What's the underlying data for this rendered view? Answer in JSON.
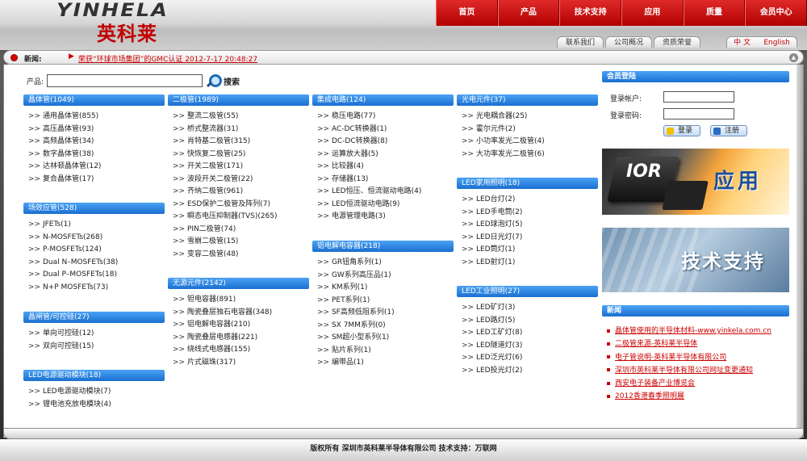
{
  "header": {
    "logo_en": "YINHELA",
    "logo_cn": "英科莱",
    "nav": [
      "首页",
      "产品",
      "技术支持",
      "应用",
      "质量",
      "会员中心"
    ],
    "subnav": [
      "联系我们",
      "公司概况",
      "资质荣誉"
    ],
    "lang": [
      "中 文",
      "English"
    ]
  },
  "news_ticker": {
    "label": "新闻:",
    "arrow": "▶",
    "text": "荣获“环球市场集团”的GMC认证   2012-7-17 20:48:27"
  },
  "search": {
    "label": "产品:",
    "value": "",
    "button": "搜索"
  },
  "categories": {
    "transistor": {
      "title": "晶体管(1049)",
      "items": [
        "通用晶体管(855)",
        "高压晶体管(93)",
        "高频晶体管(34)",
        "数字晶体管(38)",
        "达林顿晶体管(12)",
        "复合晶体管(17)"
      ]
    },
    "fet": {
      "title": "场效应管(528)",
      "items": [
        "JFETs(1)",
        "N-MOSFETs(268)",
        "P-MOSFETs(124)",
        "Dual N–MOSFETs(38)",
        "Dual P–MOSFETs(18)",
        "N+P MOSFETs(73)"
      ]
    },
    "thyristor": {
      "title": "晶闸管/可控硅(27)",
      "items": [
        "单向可控硅(12)",
        "双向可控硅(15)"
      ]
    },
    "led_driver": {
      "title": "LED电源驱动模块(18)",
      "items": [
        "LED电源驱动模块(7)",
        "锂电池充放电模块(4)"
      ]
    },
    "diode": {
      "title": "二极管(1989)",
      "items": [
        "整流二极管(55)",
        "桥式整流器(31)",
        "肖特基二极管(315)",
        "快恢复二极管(25)",
        "开关二极管(171)",
        "波段开关二极管(22)",
        "齐纳二极管(961)",
        "ESD保护二极管及阵列(7)",
        "瞬态电压抑制器(TVS)(265)",
        "PIN二极管(74)",
        "雪崩二极管(15)",
        "变容二极管(48)"
      ]
    },
    "passive": {
      "title": "无源元件(2142)",
      "items": [
        "钽电容器(891)",
        "陶瓷叠层独石电容器(348)",
        "铝电解电容器(210)",
        "陶瓷叠层电感器(221)",
        "绕线式电感器(155)",
        "片式磁珠(317)"
      ]
    },
    "ic": {
      "title": "集成电路(124)",
      "items": [
        "稳压电路(77)",
        "AC-DC转换器(1)",
        "DC-DC转换器(8)",
        "运算放大器(5)",
        "比较器(4)",
        "存储器(13)",
        "LED恒压、恒流驱动电路(4)",
        "LED恒流驱动电路(9)",
        "电源管理电路(3)"
      ]
    },
    "al_cap": {
      "title": "铝电解电容器(218)",
      "items": [
        "GR钮角系列(1)",
        "GW系列高压品(1)",
        "KM系列(1)",
        "PET系列(1)",
        "SF高频低阻系列(1)",
        "SX 7MM系列(0)",
        "SM超小型系列(1)",
        "贴片系列(1)",
        "编带品(1)"
      ]
    },
    "opto": {
      "title": "光电元件(37)",
      "items": [
        "光电耦合器(25)",
        "霍尔元件(2)",
        "小功率发光二极管(4)",
        "大功率发光二极管(6)"
      ]
    },
    "led_home": {
      "title": "LED家用照明(18)",
      "items": [
        "LED台灯(2)",
        "LED手电筒(2)",
        "LED球泡灯(5)",
        "LED日光灯(7)",
        "LED筒灯(1)",
        "LED射灯(1)"
      ]
    },
    "led_industrial": {
      "title": "LED工业照明(27)",
      "items": [
        "LED矿灯(3)",
        "LED路灯(5)",
        "LED工矿灯(8)",
        "LED隧道灯(3)",
        "LED泛光灯(6)",
        "LED投光灯(2)"
      ]
    }
  },
  "login": {
    "title": "会员登陆",
    "account_label": "登录帐户:",
    "password_label": "登录密码:",
    "account_value": "",
    "password_value": "",
    "login_button": "登录",
    "register_button": "注册"
  },
  "banners": {
    "app": "应用",
    "app_chip": "IOR",
    "tech": "技术支持"
  },
  "news": {
    "title": "新闻",
    "items": [
      "晶体管使用的半导体材料-www.yinkela.com.cn",
      "二极管来源-英科莱半导体",
      "电子管说明-英科莱半导体有限公司",
      "深圳市英科莱半导体有限公司网址变更通知",
      "西安电子装备产业博览会",
      "2012香港春季照明展"
    ]
  },
  "footer": {
    "copyright": "版权所有  深圳市英科莱半导体有限公司    技术支持：万联网"
  },
  "colors": {
    "nav_red": "#c40000",
    "category_blue": "#2a7fdc",
    "link_red": "#cc0000"
  }
}
